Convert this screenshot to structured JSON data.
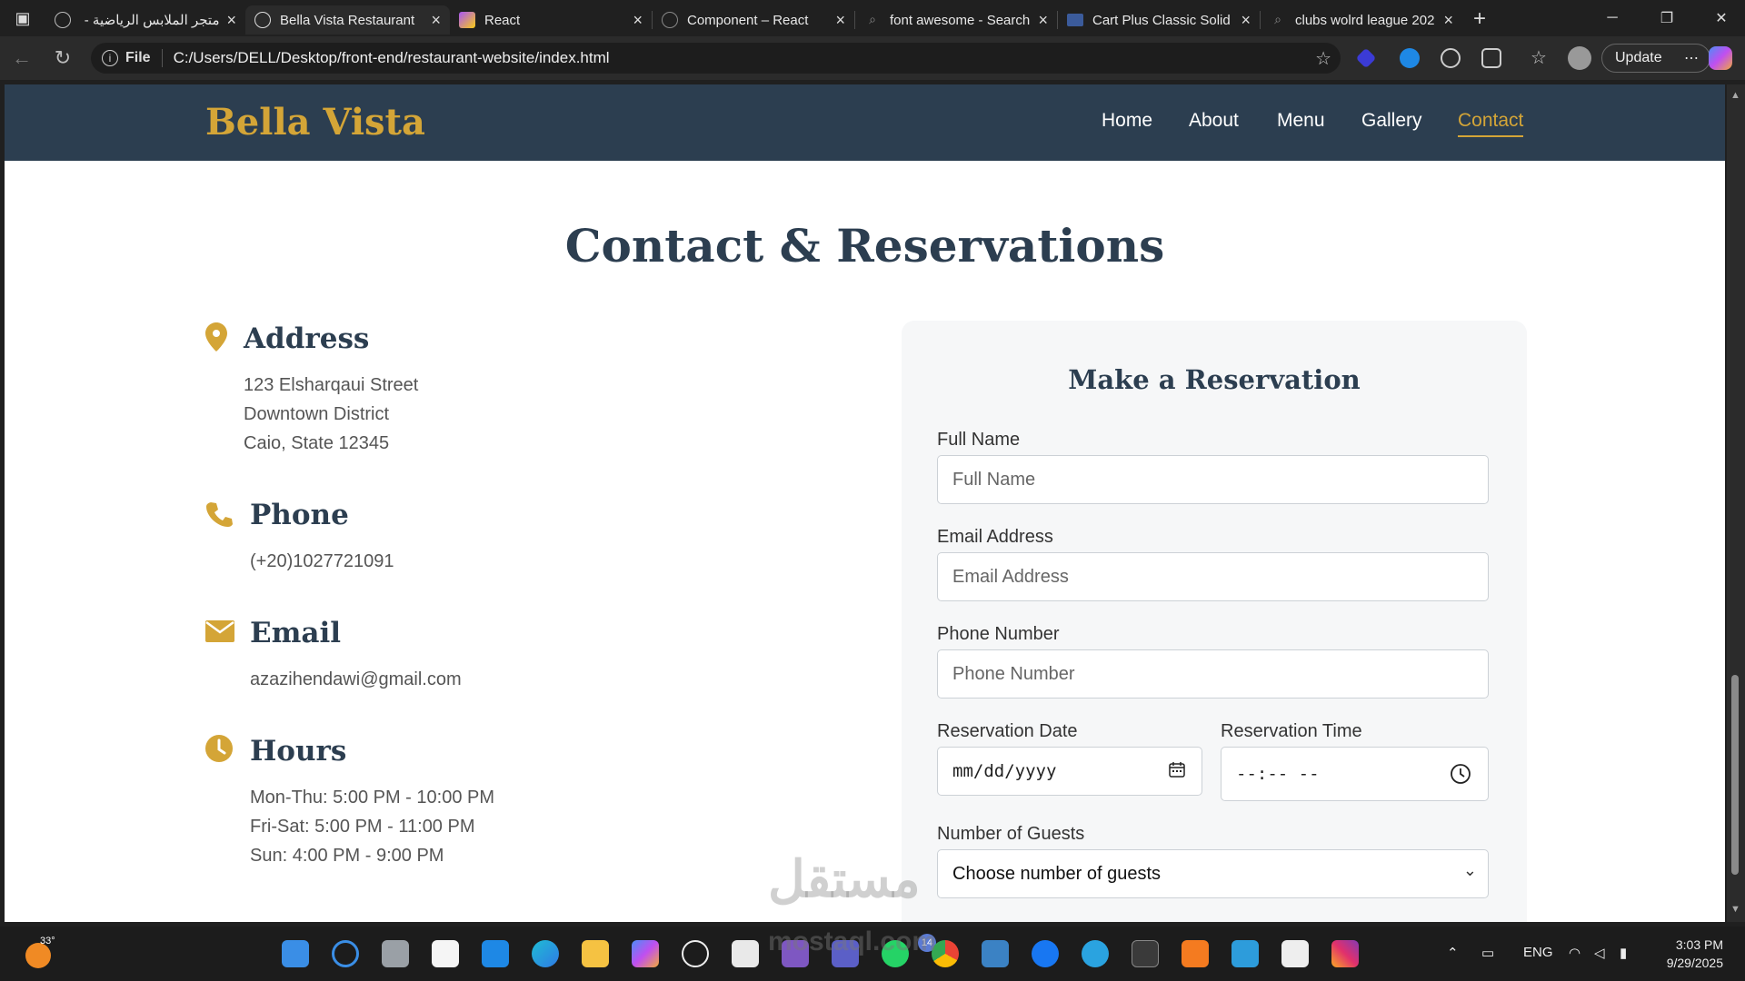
{
  "browser": {
    "tabs": [
      {
        "label": "متجر الملابس الرياضية -",
        "icon": "globe-icon"
      },
      {
        "label": "Bella Vista Restaurant",
        "icon": "globe-icon",
        "active": true
      },
      {
        "label": "React",
        "icon": "vite-icon"
      },
      {
        "label": "Component – React",
        "icon": "react-icon"
      },
      {
        "label": "font awesome - Search",
        "icon": "search-icon"
      },
      {
        "label": "Cart Plus Classic Solid I",
        "icon": "flag-icon"
      },
      {
        "label": "clubs wolrd league 202",
        "icon": "search-icon"
      }
    ],
    "address": {
      "scheme_label": "File",
      "url": "C:/Users/DELL/Desktop/front-end/restaurant-website/index.html"
    },
    "update_label": "Update"
  },
  "site": {
    "logo": "Bella Vista",
    "nav": [
      "Home",
      "About",
      "Menu",
      "Gallery",
      "Contact"
    ],
    "active_nav": "Contact",
    "section_title": "Contact & Reservations",
    "address": {
      "heading": "Address",
      "lines": [
        "123 Elsharqaui Street",
        "Downtown District",
        "Caio, State 12345"
      ]
    },
    "phone": {
      "heading": "Phone",
      "value": "(+20)1027721091"
    },
    "email": {
      "heading": "Email",
      "value": "azazihendawi@gmail.com"
    },
    "hours": {
      "heading": "Hours",
      "lines": [
        "Mon-Thu: 5:00 PM - 10:00 PM",
        "Fri-Sat: 5:00 PM - 11:00 PM",
        "Sun: 4:00 PM - 9:00 PM"
      ]
    },
    "form": {
      "title": "Make a Reservation",
      "full_name": {
        "label": "Full Name",
        "placeholder": "Full Name"
      },
      "email": {
        "label": "Email Address",
        "placeholder": "Email Address"
      },
      "phone": {
        "label": "Phone Number",
        "placeholder": "Phone Number"
      },
      "date": {
        "label": "Reservation Date",
        "value": "mm/dd/yyyy"
      },
      "time": {
        "label": "Reservation Time",
        "value": "--:-- --"
      },
      "guests": {
        "label": "Number of Guests",
        "value": "Choose number of guests"
      }
    },
    "accent_color": "#d4a537",
    "header_color": "#2c3e50"
  },
  "watermark": {
    "text": "مستقل",
    "sub": "mostaql.com"
  },
  "taskbar": {
    "weather": "33°",
    "whatsapp_badge": "14",
    "language": "ENG",
    "time": "3:03 PM",
    "date": "9/29/2025"
  }
}
